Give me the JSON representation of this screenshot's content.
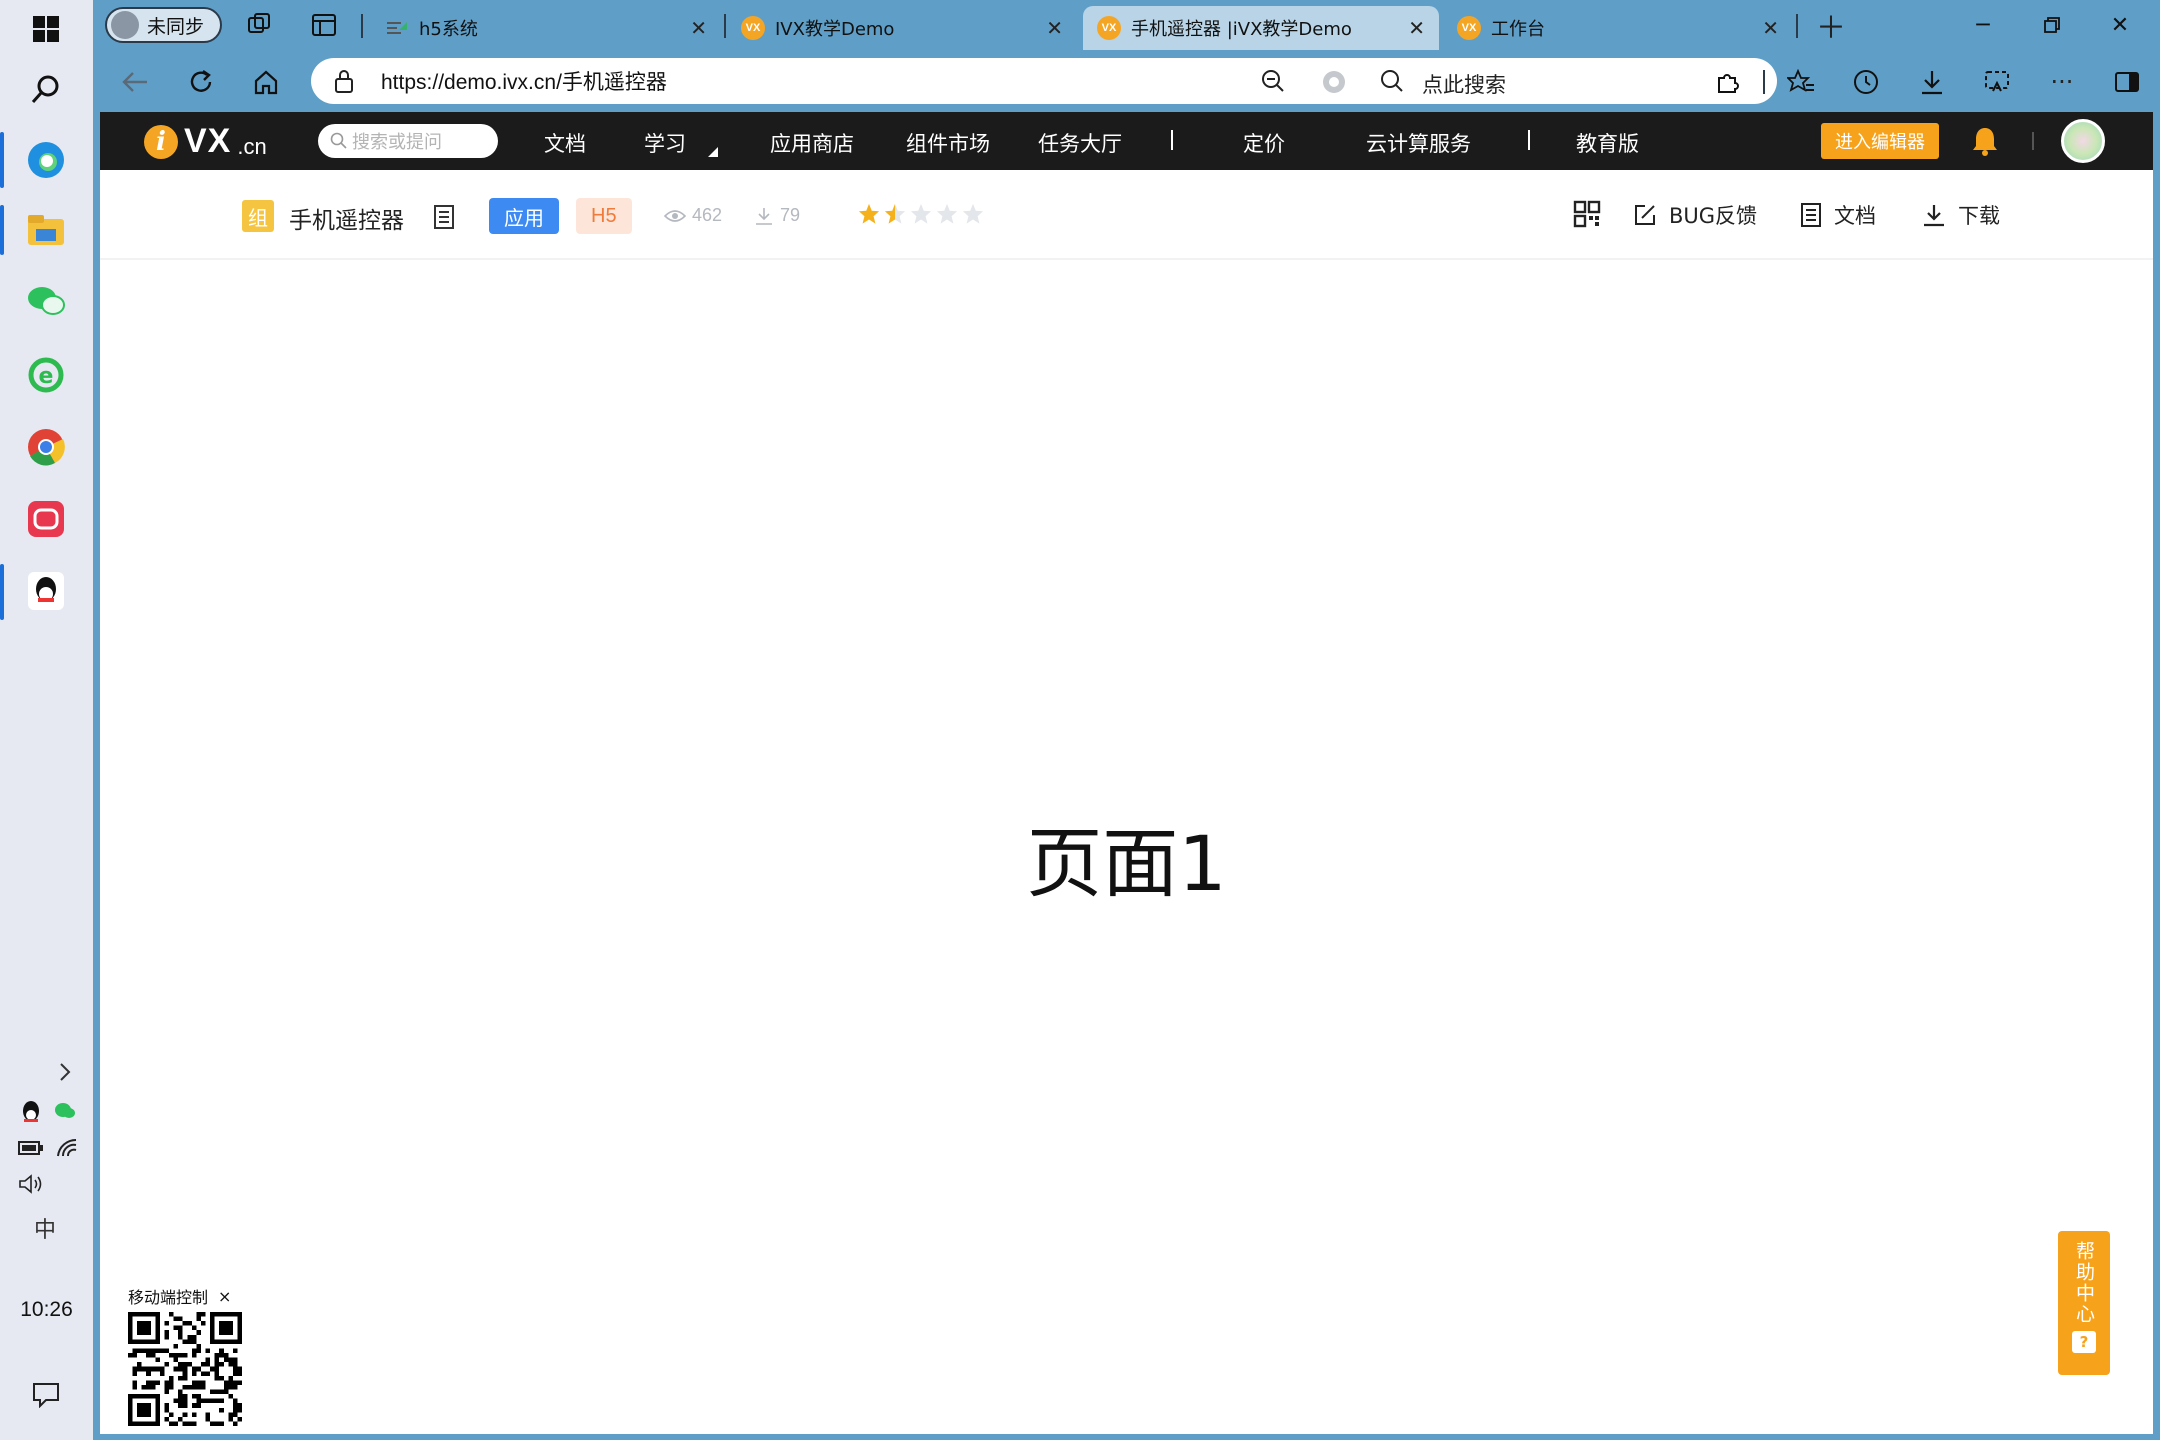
{
  "taskbar": {
    "clock": "10:26",
    "tray_ime": "中"
  },
  "browser": {
    "profile_label": "未同步",
    "tabs": [
      {
        "title": "h5系统",
        "icon": "h5-system-icon"
      },
      {
        "title": "IVX教学Demo",
        "icon": "vx-icon"
      },
      {
        "title": "手机遥控器 |iVX教学Demo",
        "icon": "vx-icon",
        "active": true
      },
      {
        "title": "工作台",
        "icon": "vx-icon"
      }
    ],
    "url": "https://demo.ivx.cn/手机遥控器",
    "search_placeholder": "点此搜索",
    "favicon_text": "VX"
  },
  "site_nav": {
    "logo_vx": "VX",
    "logo_cn": ".cn",
    "logo_i": "i",
    "search_placeholder": "搜索或提问",
    "links": {
      "docs": "文档",
      "learn": "学习",
      "app_store": "应用商店",
      "component_market": "组件市场",
      "task_hall": "任务大厅",
      "pricing": "定价",
      "cloud": "云计算服务",
      "education": "教育版"
    },
    "editor_button": "进入编辑器"
  },
  "app_bar": {
    "icon_char": "组",
    "name": "手机遥控器",
    "tag_app": "应用",
    "tag_h5": "H5",
    "views": "462",
    "downloads": "79",
    "rating": 1.5,
    "rating_max": 5,
    "actions": {
      "bug": "BUG反馈",
      "docs": "文档",
      "download": "下载"
    }
  },
  "page": {
    "main_text": "页面1"
  },
  "qr_panel": {
    "label": "移动端控制",
    "close": "×"
  },
  "help": {
    "label": "帮助中心",
    "icon": "?"
  },
  "colors": {
    "browser_chrome": "#5f9fc7",
    "accent_orange": "#f7a21b",
    "tag_blue": "#3d8bf2",
    "site_nav_bg": "#1b1b1b"
  }
}
